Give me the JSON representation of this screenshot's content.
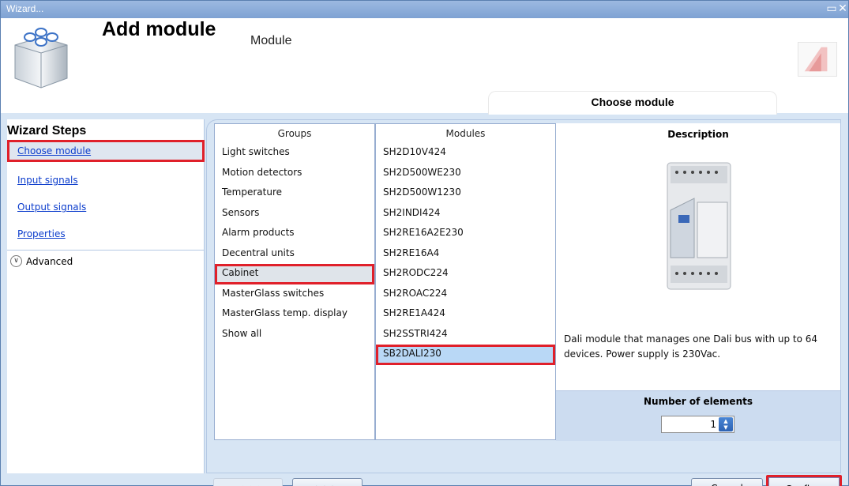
{
  "window": {
    "title": "Wizard..."
  },
  "header": {
    "title": "Add module",
    "subtitle": "Module",
    "tab_heading": "Choose module"
  },
  "sidebar": {
    "title": "Wizard Steps",
    "steps": [
      {
        "label": "Choose module"
      },
      {
        "label": "Input signals"
      },
      {
        "label": "Output signals"
      },
      {
        "label": "Properties"
      }
    ],
    "advanced_label": "Advanced"
  },
  "groups": {
    "header": "Groups",
    "items": [
      "Light switches",
      "Motion detectors",
      "Temperature",
      "Sensors",
      "Alarm products",
      "Decentral units",
      "Cabinet",
      "MasterGlass switches",
      "MasterGlass temp. display",
      "Show all"
    ],
    "selected": "Cabinet"
  },
  "modules": {
    "header": "Modules",
    "items": [
      "SH2D10V424",
      "SH2D500WE230",
      "SH2D500W1230",
      "SH2INDI424",
      "SH2RE16A2E230",
      "SH2RE16A4",
      "SH2RODC224",
      "SH2ROAC224",
      "SH2RE1A424",
      "SH2SSTRI424",
      "SB2DALI230"
    ],
    "selected": "SB2DALI230"
  },
  "description": {
    "title": "Description",
    "text": "Dali module that manages one Dali bus with up to 64 devices. Power supply is 230Vac.",
    "number_title": "Number of elements",
    "number_value": "1"
  },
  "footer": {
    "prev_label": "<<<",
    "next_label": ">>>",
    "cancel_label": "Cancel",
    "confirm_label": "Confirm"
  }
}
